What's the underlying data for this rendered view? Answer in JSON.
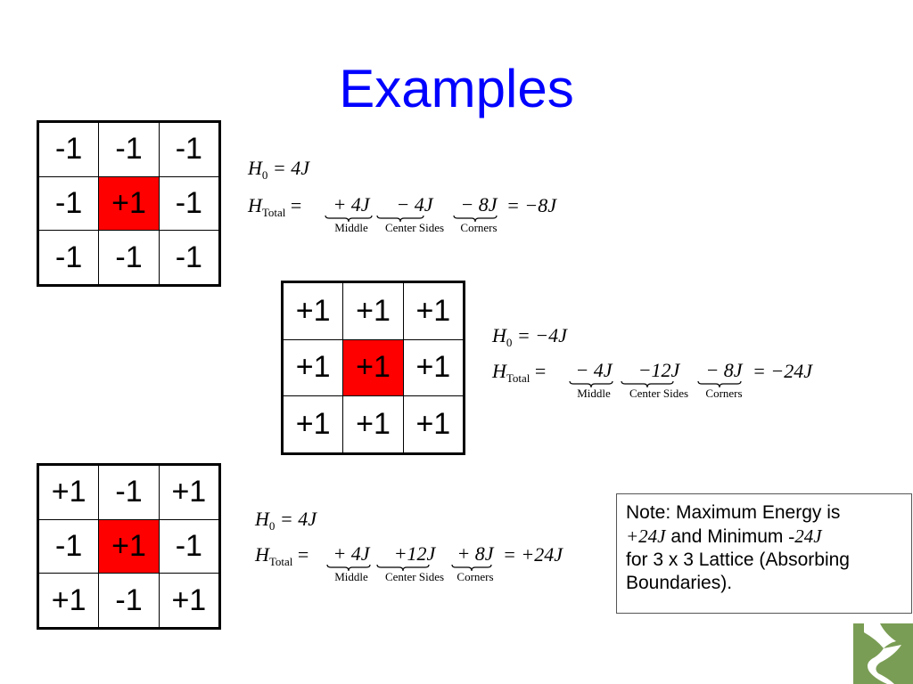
{
  "slide": {
    "title": "Examples"
  },
  "examples": [
    {
      "grid": [
        [
          "-1",
          "-1",
          "-1"
        ],
        [
          "-1",
          "+1",
          "-1"
        ],
        [
          "-1",
          "-1",
          "-1"
        ]
      ],
      "h0_lhs": "H",
      "h0_sub": "0",
      "h0_rhs": "= 4J",
      "htotal_lhs": "H",
      "htotal_sub": "Total",
      "terms": [
        {
          "value": "+ 4J",
          "label": "Middle"
        },
        {
          "value": "− 4J",
          "label": "Center Sides"
        },
        {
          "value": "− 8J",
          "label": "Corners"
        }
      ],
      "result": "= −8J"
    },
    {
      "grid": [
        [
          "+1",
          "+1",
          "+1"
        ],
        [
          "+1",
          "+1",
          "+1"
        ],
        [
          "+1",
          "+1",
          "+1"
        ]
      ],
      "h0_lhs": "H",
      "h0_sub": "0",
      "h0_rhs": "= −4J",
      "htotal_lhs": "H",
      "htotal_sub": "Total",
      "terms": [
        {
          "value": "− 4J",
          "label": "Middle"
        },
        {
          "value": "−12J",
          "label": "Center Sides"
        },
        {
          "value": "− 8J",
          "label": "Corners"
        }
      ],
      "result": "= −24J"
    },
    {
      "grid": [
        [
          "+1",
          "-1",
          "+1"
        ],
        [
          "-1",
          "+1",
          "-1"
        ],
        [
          "+1",
          "-1",
          "+1"
        ]
      ],
      "h0_lhs": "H",
      "h0_sub": "0",
      "h0_rhs": "= 4J",
      "htotal_lhs": "H",
      "htotal_sub": "Total",
      "terms": [
        {
          "value": "+ 4J",
          "label": "Middle"
        },
        {
          "value": "+12J",
          "label": "Center Sides"
        },
        {
          "value": "+ 8J",
          "label": "Corners"
        }
      ],
      "result": "= +24J"
    }
  ],
  "note": {
    "line1": "Note: Maximum Energy is",
    "max_value": "+24J",
    "and_min": " and Minimum ",
    "min_value": "-24J",
    "line3": "for 3 x 3 Lattice (Absorbing",
    "line4": "Boundaries)."
  },
  "colors": {
    "title": "#0000ff",
    "center_cell": "#ff0000",
    "logo_bg": "#7a9d55"
  },
  "logo": {
    "icon": "stylized-s-logo-icon"
  }
}
